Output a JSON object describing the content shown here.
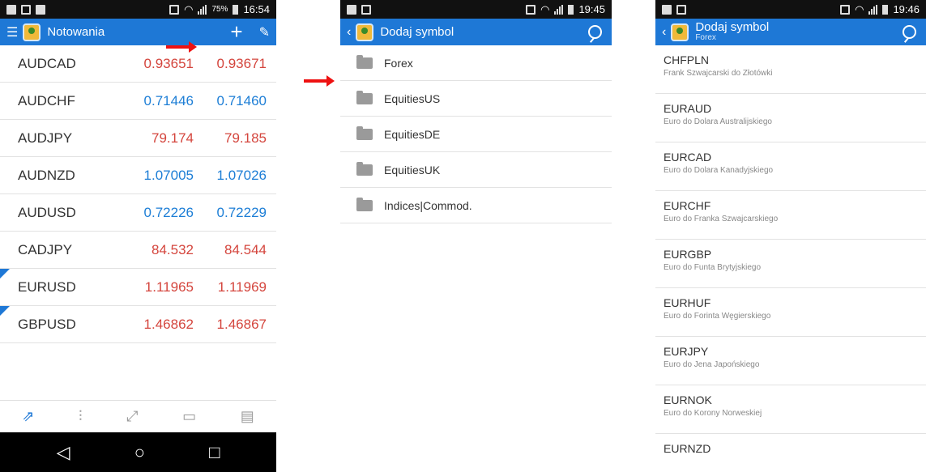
{
  "colors": {
    "accent": "#1e78d6",
    "up": "#1d7ed6",
    "down": "#d4453d",
    "arrow": "#e11111"
  },
  "screen1": {
    "status": {
      "battery": "75%",
      "time": "16:54"
    },
    "title": "Notowania",
    "rows": [
      {
        "symbol": "AUDCAD",
        "bid": "0.93651",
        "ask": "0.93671",
        "dir": "down",
        "marked": false
      },
      {
        "symbol": "AUDCHF",
        "bid": "0.71446",
        "ask": "0.71460",
        "dir": "up",
        "marked": false
      },
      {
        "symbol": "AUDJPY",
        "bid": "79.174",
        "ask": "79.185",
        "dir": "down",
        "marked": false
      },
      {
        "symbol": "AUDNZD",
        "bid": "1.07005",
        "ask": "1.07026",
        "dir": "up",
        "marked": false
      },
      {
        "symbol": "AUDUSD",
        "bid": "0.72226",
        "ask": "0.72229",
        "dir": "up",
        "marked": false
      },
      {
        "symbol": "CADJPY",
        "bid": "84.532",
        "ask": "84.544",
        "dir": "down",
        "marked": false
      },
      {
        "symbol": "EURUSD",
        "bid": "1.11965",
        "ask": "1.11969",
        "dir": "down",
        "marked": true
      },
      {
        "symbol": "GBPUSD",
        "bid": "1.46862",
        "ask": "1.46867",
        "dir": "down",
        "marked": true
      }
    ],
    "bottom_nav": [
      "quotes-icon",
      "chart-icon",
      "trade-icon",
      "history-icon",
      "journal-icon"
    ]
  },
  "screen2": {
    "status": {
      "time": "19:45"
    },
    "title": "Dodaj symbol",
    "groups": [
      "Forex",
      "EquitiesUS",
      "EquitiesDE",
      "EquitiesUK",
      "Indices|Commod."
    ]
  },
  "screen3": {
    "status": {
      "time": "19:46"
    },
    "title": "Dodaj symbol",
    "subtitle": "Forex",
    "symbols": [
      {
        "name": "CHFPLN",
        "desc": "Frank Szwajcarski do Złotówki"
      },
      {
        "name": "EURAUD",
        "desc": "Euro do Dolara Australijskiego"
      },
      {
        "name": "EURCAD",
        "desc": "Euro do Dolara Kanadyjskiego"
      },
      {
        "name": "EURCHF",
        "desc": "Euro do Franka Szwajcarskiego"
      },
      {
        "name": "EURGBP",
        "desc": "Euro do Funta Brytyjskiego"
      },
      {
        "name": "EURHUF",
        "desc": "Euro do Forinta Węgierskiego"
      },
      {
        "name": "EURJPY",
        "desc": "Euro do Jena Japońskiego"
      },
      {
        "name": "EURNOK",
        "desc": "Euro do Korony Norweskiej"
      },
      {
        "name": "EURNZD",
        "desc": ""
      }
    ]
  }
}
